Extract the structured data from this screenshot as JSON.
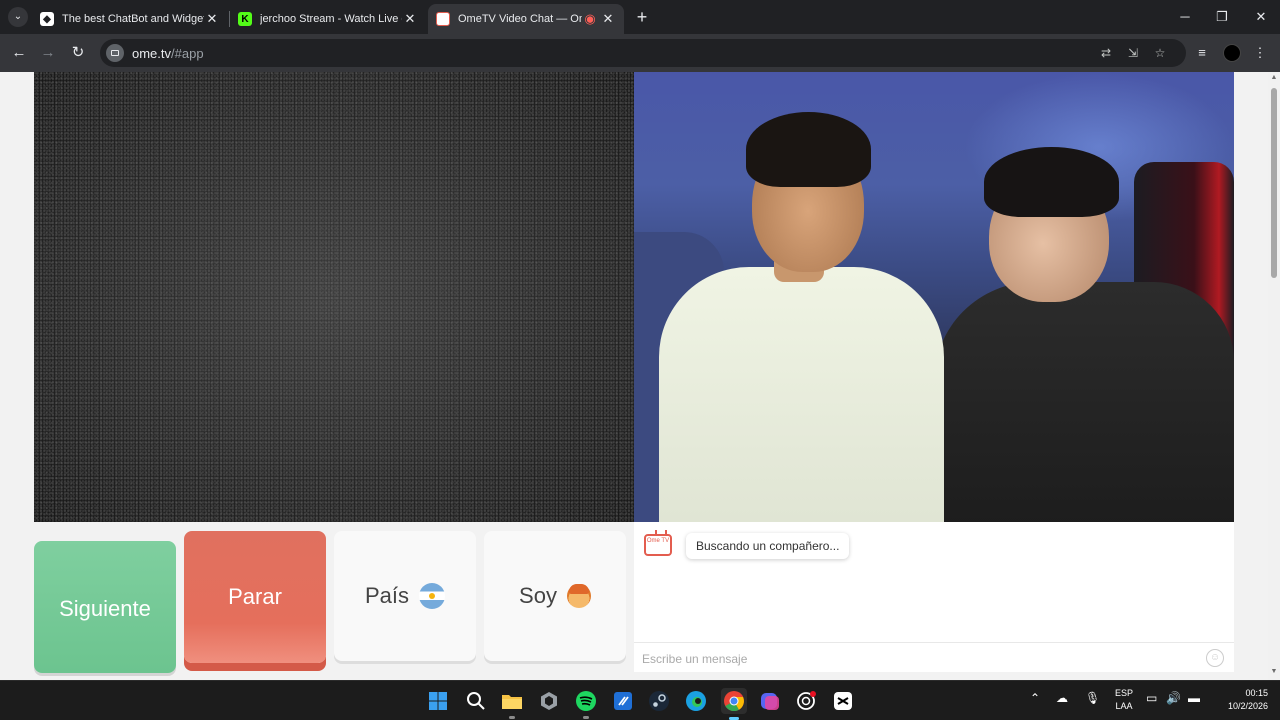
{
  "browser": {
    "tabs": [
      {
        "title": "The best ChatBot and Widgets"
      },
      {
        "title": "jerchoo Stream - Watch Live on"
      },
      {
        "title": "OmeTV Video Chat — Ome"
      }
    ],
    "url_host": "ome.tv",
    "url_path": "/#app"
  },
  "app": {
    "buttons": {
      "next": "Siguiente",
      "stop": "Parar",
      "country": "País",
      "gender": "Soy"
    },
    "chat": {
      "bot_label": "Ome TV",
      "status_message": "Buscando un compañero...",
      "input_placeholder": "Escribe un mensaje"
    }
  },
  "taskbar": {
    "language": "ESP",
    "layout": "LAA",
    "time": "00:15",
    "date": "10/2/2026"
  },
  "colors": {
    "next_button": "#7fcf9f",
    "stop_button": "#e56f5c",
    "brand_red": "#e35d4f"
  }
}
